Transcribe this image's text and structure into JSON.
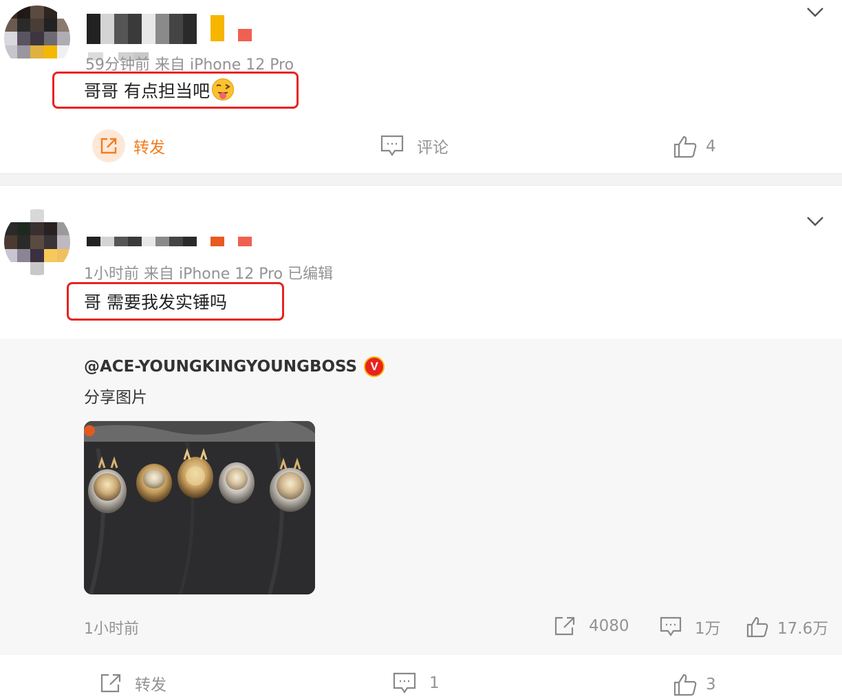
{
  "post1": {
    "meta": "59分钟前 来自 iPhone 12 Pro",
    "content": "哥哥 有点担当吧",
    "actions": {
      "forward_label": "转发",
      "comment_label": "评论",
      "like_count": "4"
    }
  },
  "post2": {
    "meta": "1小时前 来自 iPhone 12 Pro 已编辑",
    "content": "哥 需要我发实锤吗",
    "repost": {
      "user": "@ACE-YOUNGKINGYOUNGBOSS",
      "verified_badge": "V",
      "text": "分享图片",
      "time": "1小时前",
      "forward_count": "4080",
      "comment_count": "1万",
      "like_count": "17.6万"
    },
    "actions": {
      "forward_label": "转发",
      "comment_count": "1",
      "like_count": "3"
    }
  },
  "colors": {
    "highlight": "#e8231f",
    "accent": "#f07c1e",
    "muted": "#939393"
  }
}
